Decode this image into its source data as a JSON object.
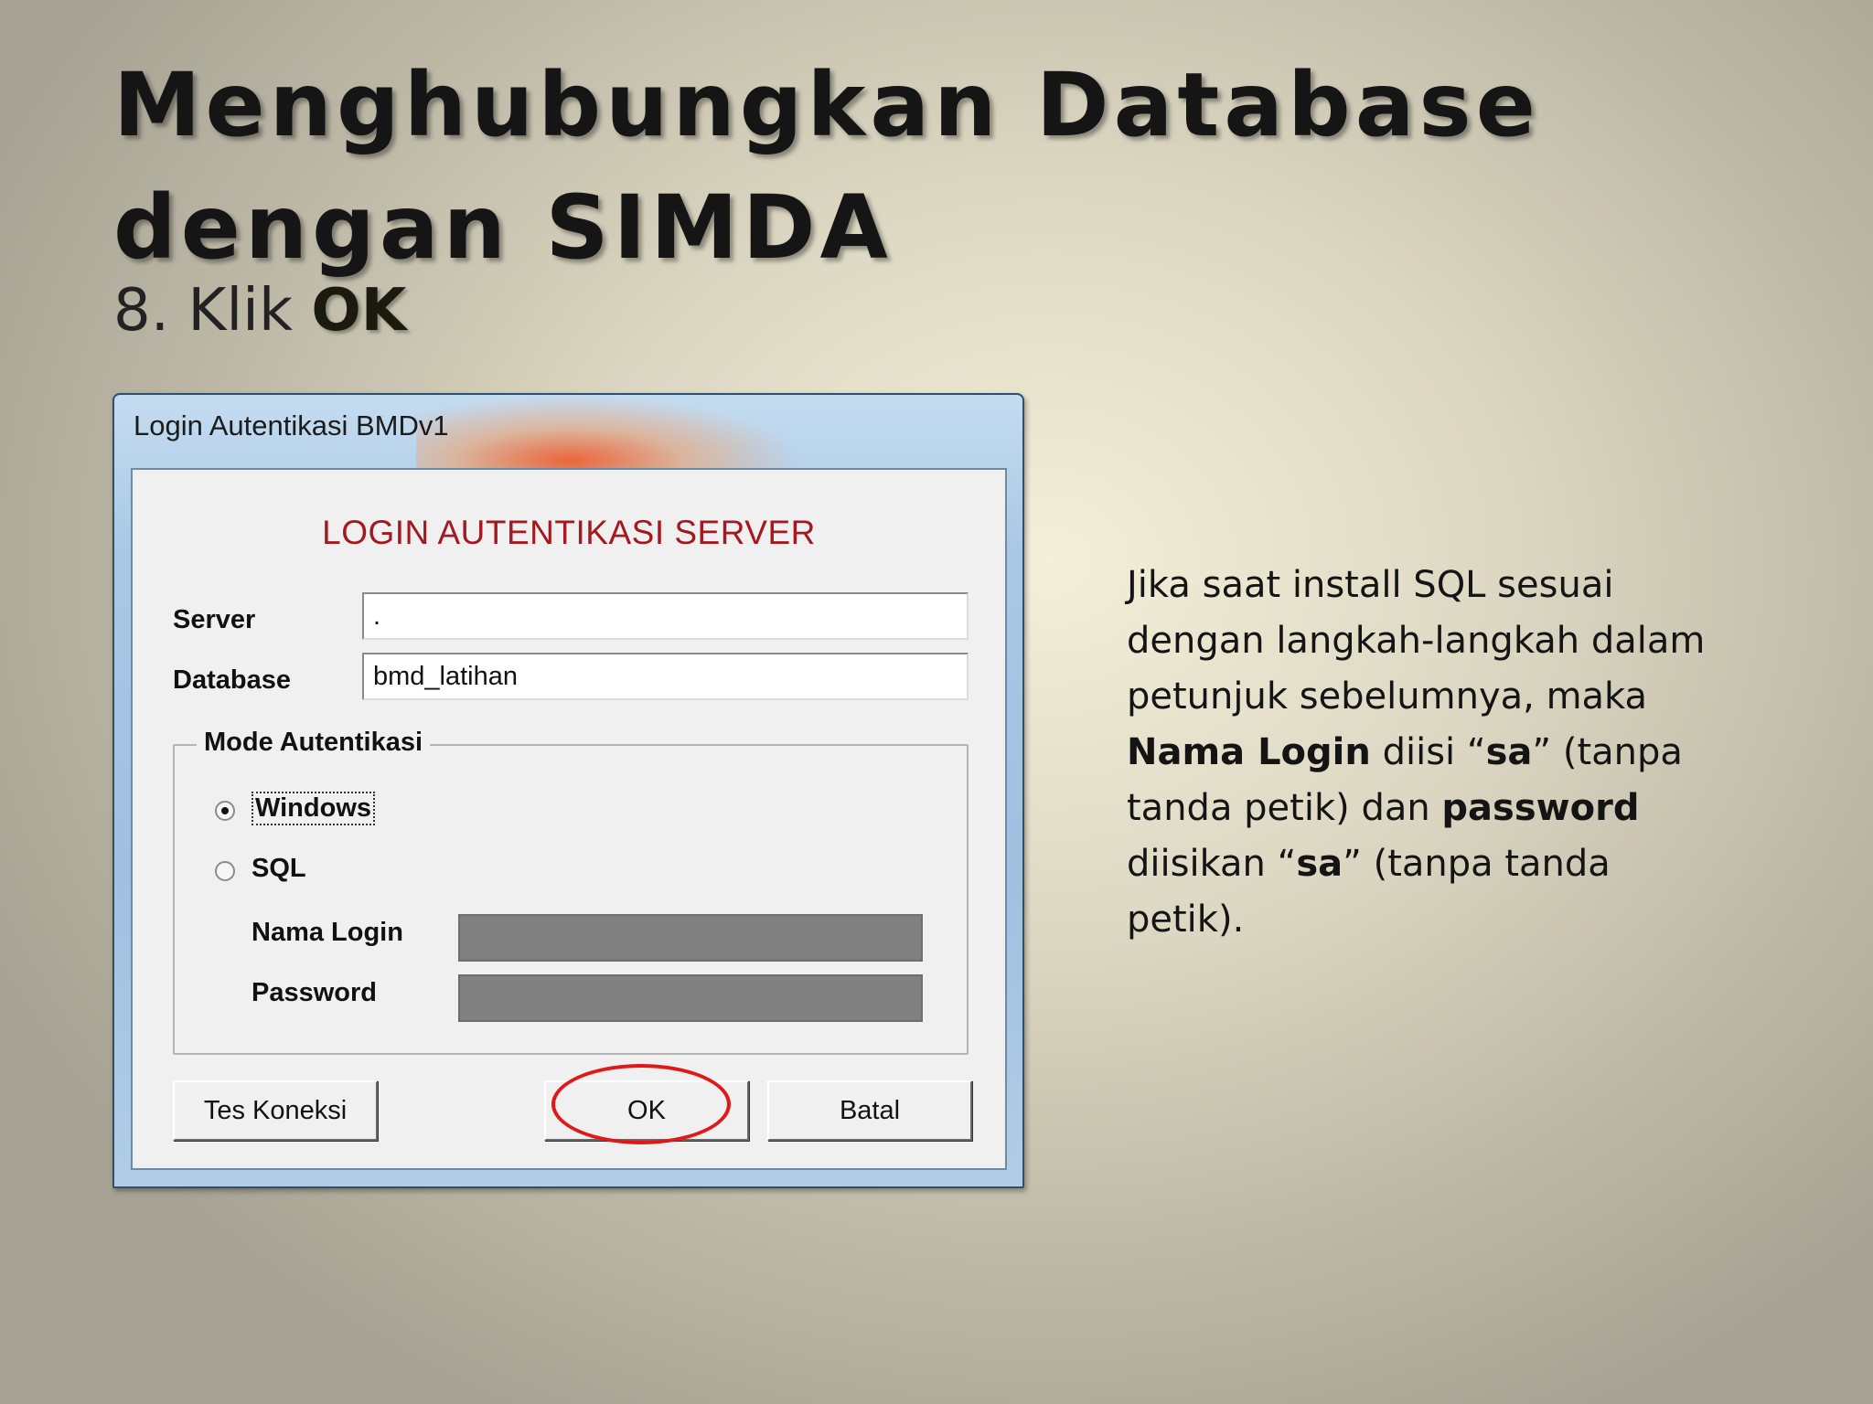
{
  "slide": {
    "title": "Menghubungkan Database dengan SIMDA",
    "step_number": "8. Klik ",
    "step_emphasis": "OK"
  },
  "dialog": {
    "window_title": "Login Autentikasi BMDv1",
    "heading": "LOGIN AUTENTIKASI SERVER",
    "server_label": "Server",
    "server_value": ".",
    "database_label": "Database",
    "database_value": "bmd_latihan",
    "group_label": "Mode Autentikasi",
    "radio_windows": "Windows",
    "radio_sql": "SQL",
    "selected_mode": "Windows",
    "login_name_label": "Nama Login",
    "password_label": "Password",
    "test_button": "Tes Koneksi",
    "ok_button": "OK",
    "cancel_button": "Batal"
  },
  "description": {
    "part1": "Jika saat install SQL sesuai dengan langkah-langkah dalam petunjuk sebelumnya, maka ",
    "bold1": "Nama Login",
    "part2": " diisi “",
    "bold2": "sa",
    "part3": "” (tanpa tanda petik) dan ",
    "bold3": "password",
    "part4": " diisikan “",
    "bold4": "sa",
    "part5": "” (tanpa tanda petik)."
  },
  "colors": {
    "heading_red": "#a3191f",
    "highlight_circle": "#e01818"
  }
}
